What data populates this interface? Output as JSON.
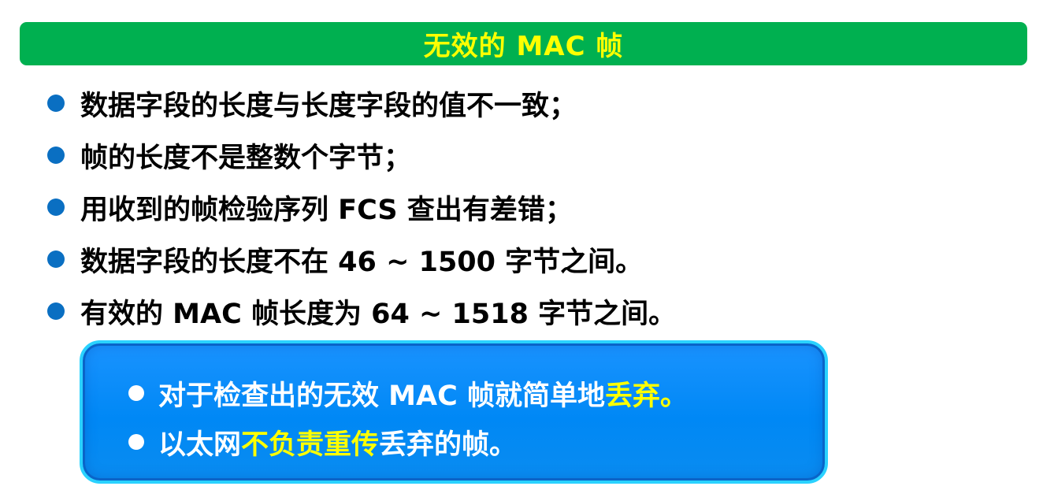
{
  "title": "无效的 MAC 帧",
  "main_items": [
    "数据字段的长度与长度字段的值不一致；",
    "帧的长度不是整数个字节；",
    "用收到的帧检验序列 FCS 查出有差错；",
    "数据字段的长度不在 46 ~ 1500 字节之间。",
    "有效的 MAC 帧长度为 64 ~ 1518 字节之间。"
  ],
  "callout": {
    "item1": {
      "part1": "对于检查出的无效 MAC 帧就简单地",
      "highlight": "丢弃。"
    },
    "item2": {
      "part1": "以太网",
      "highlight": "不负责重传",
      "part2": "丢弃的帧。"
    }
  },
  "colors": {
    "title_bg": "#00b050",
    "title_text": "#ffff00",
    "bullet": "#0a6fc2",
    "callout_bg": "#0088f5",
    "callout_border": "#2ad2ff",
    "highlight": "#ffff00"
  }
}
